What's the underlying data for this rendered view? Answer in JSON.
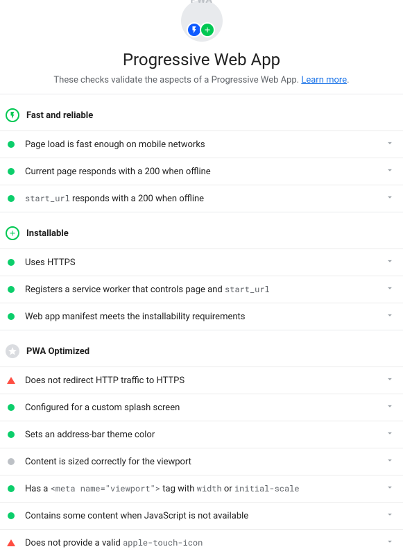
{
  "header": {
    "logo_text": "PWA",
    "title": "Progressive Web App",
    "subtitle_prefix": "These checks validate the aspects of a Progressive Web App. ",
    "learn_more": "Learn more",
    "subtitle_suffix": "."
  },
  "categories": [
    {
      "id": "fast",
      "title": "Fast and reliable",
      "icon": "lightning",
      "audits": [
        {
          "status": "pass",
          "title": "Page load is fast enough on mobile networks"
        },
        {
          "status": "pass",
          "title": "Current page responds with a 200 when offline"
        },
        {
          "status": "pass",
          "title": "<code>start_url</code> responds with a 200 when offline",
          "html": true
        }
      ]
    },
    {
      "id": "installable",
      "title": "Installable",
      "icon": "plus",
      "audits": [
        {
          "status": "pass",
          "title": "Uses HTTPS"
        },
        {
          "status": "pass",
          "title": "Registers a service worker that controls page and <code>start_url</code>",
          "html": true
        },
        {
          "status": "pass",
          "title": "Web app manifest meets the installability requirements"
        }
      ]
    },
    {
      "id": "optimized",
      "title": "PWA Optimized",
      "icon": "star",
      "audits": [
        {
          "status": "fail",
          "title": "Does not redirect HTTP traffic to HTTPS"
        },
        {
          "status": "pass",
          "title": "Configured for a custom splash screen"
        },
        {
          "status": "pass",
          "title": "Sets an address-bar theme color"
        },
        {
          "status": "gray",
          "title": "Content is sized correctly for the viewport"
        },
        {
          "status": "pass",
          "title": "Has a <code>&lt;meta name=\"viewport\"&gt;</code> tag with <code>width</code> or <code>initial-scale</code>",
          "html": true
        },
        {
          "status": "pass",
          "title": "Contains some content when JavaScript is not available"
        },
        {
          "status": "fail",
          "title": "Does not provide a valid <code>apple-touch-icon</code>",
          "html": true
        }
      ]
    }
  ]
}
